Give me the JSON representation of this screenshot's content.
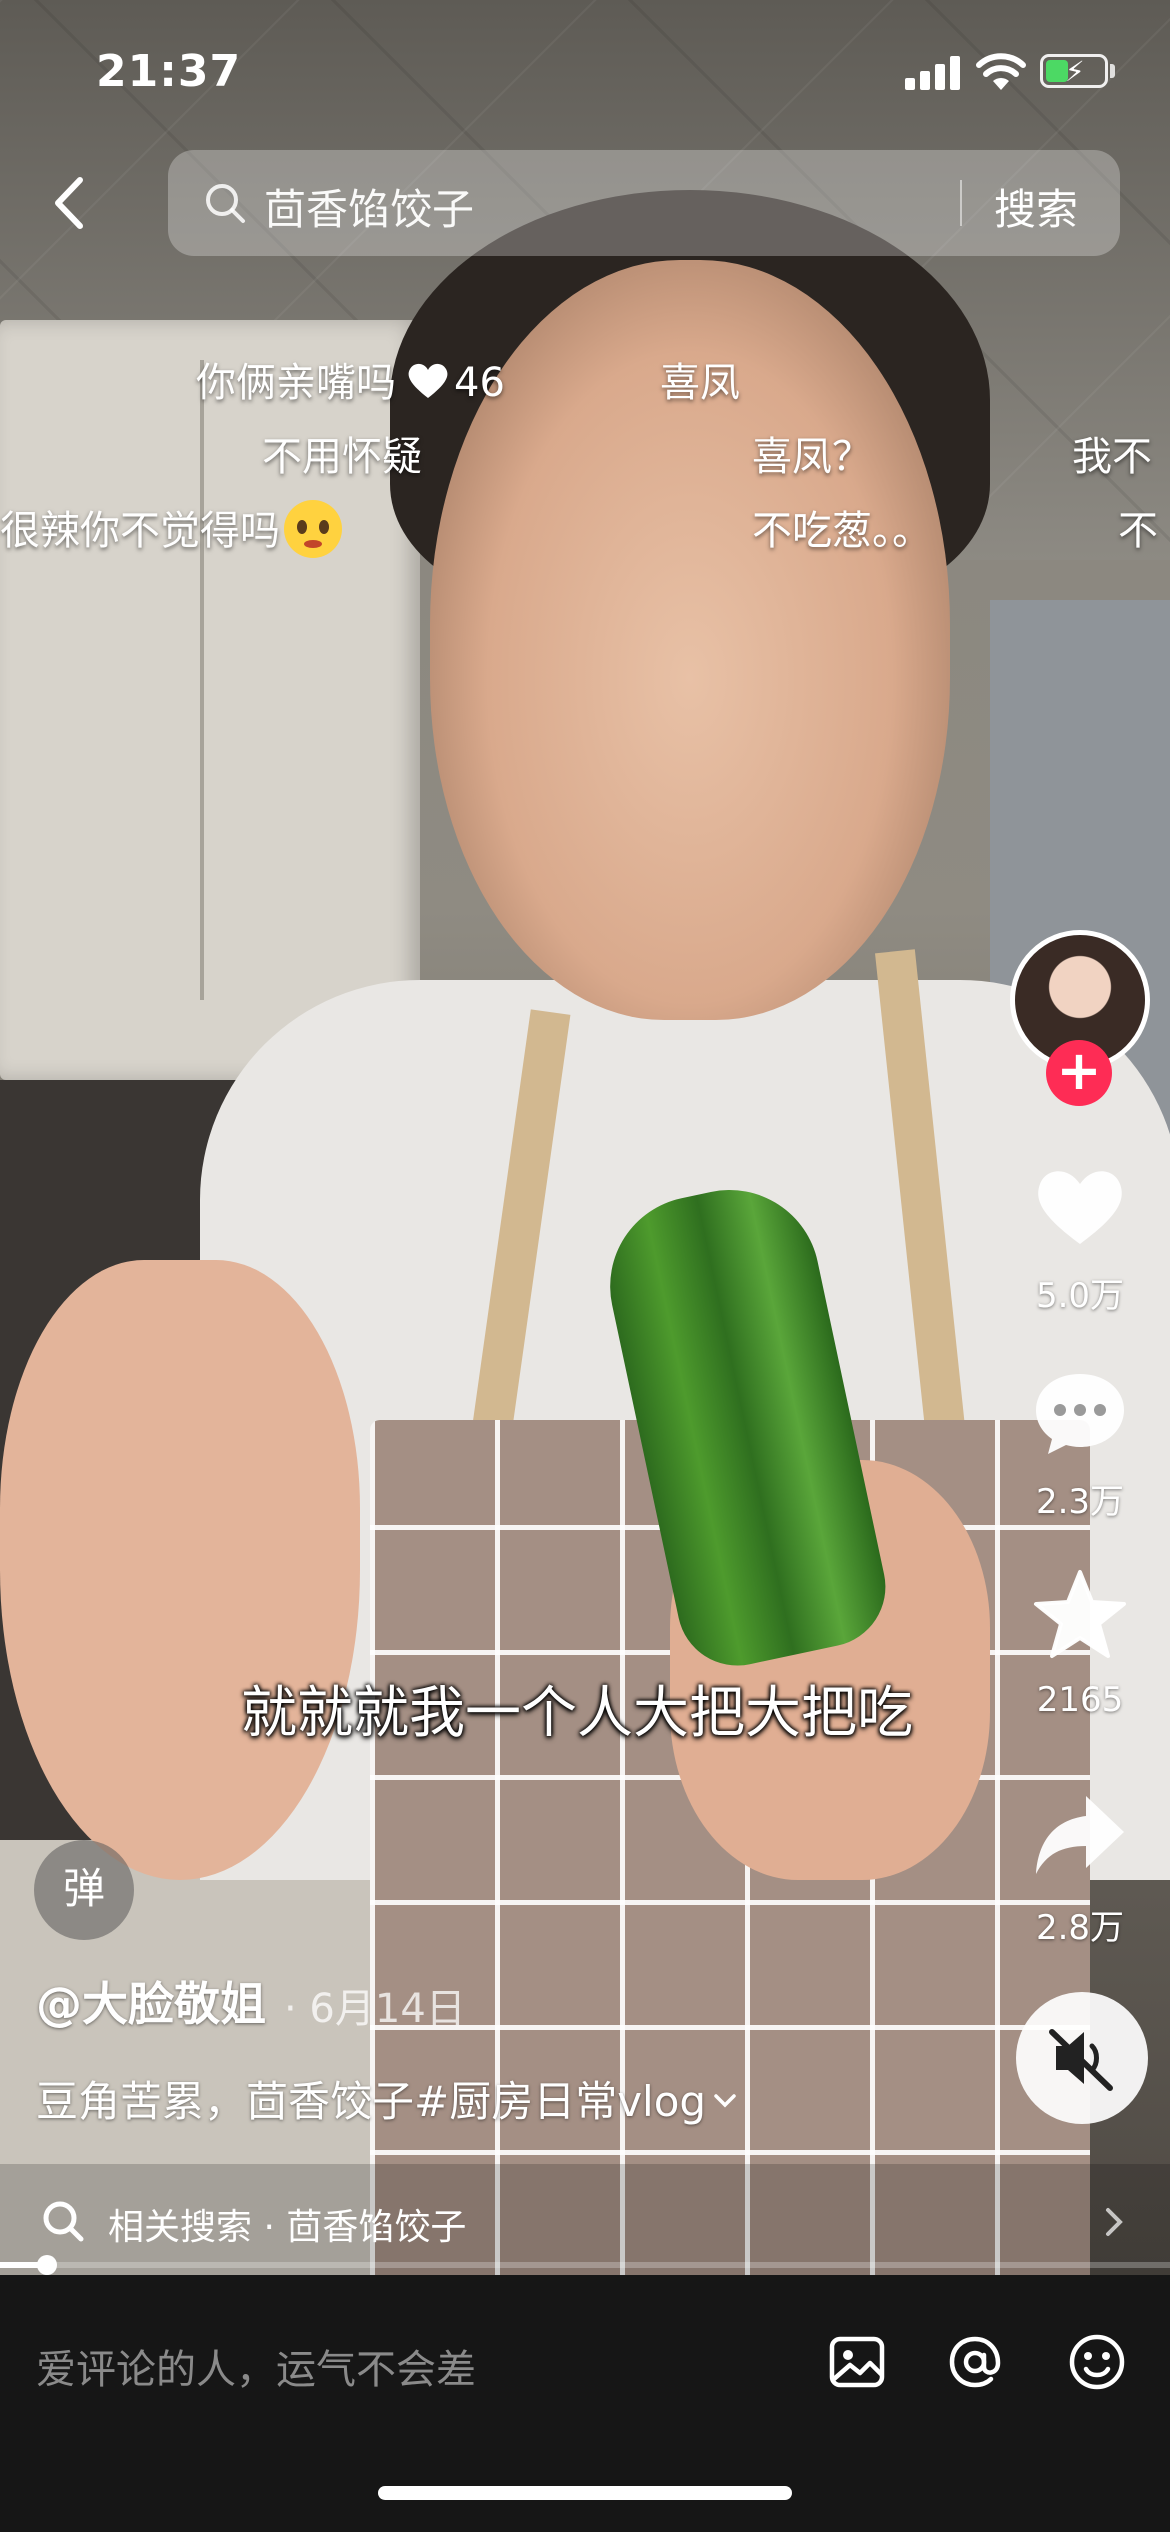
{
  "status_bar": {
    "time": "21:37",
    "battery_state": "charging"
  },
  "search": {
    "query": "茴香馅饺子",
    "button_label": "搜索"
  },
  "danmaku": [
    {
      "text": "你俩亲嘴吗",
      "likes": "46"
    },
    {
      "text": "喜凤"
    },
    {
      "text": "不用怀疑"
    },
    {
      "text": "喜凤？"
    },
    {
      "text": "我不"
    },
    {
      "text": "很辣你不觉得吗"
    },
    {
      "text": "不吃葱。。"
    },
    {
      "text": "不"
    }
  ],
  "subtitle": "就就就我一个人大把大把吃",
  "rail": {
    "like_count": "5.0万",
    "comment_count": "2.3万",
    "favorite_count": "2165",
    "share_count": "2.8万",
    "follow_symbol": "+"
  },
  "danmaku_toggle_label": "弹",
  "post": {
    "author": "@大脸敬姐",
    "date": "· 6月14日",
    "description": "豆角苦累，茴香饺子#厨房日常vlog"
  },
  "related": {
    "text": "相关搜索 · 茴香馅饺子"
  },
  "progress": {
    "fraction": 0.04
  },
  "comment_bar": {
    "placeholder": "爱评论的人，运气不会差"
  },
  "colors": {
    "follow_badge": "#fe2c55",
    "comment_bar_bg": "#161616",
    "battery_fill": "#4cd964"
  },
  "icons": [
    "back-icon",
    "search-icon",
    "heart-icon",
    "comment-icon",
    "star-icon",
    "share-icon",
    "mute-icon",
    "image-icon",
    "at-icon",
    "emoji-icon"
  ]
}
